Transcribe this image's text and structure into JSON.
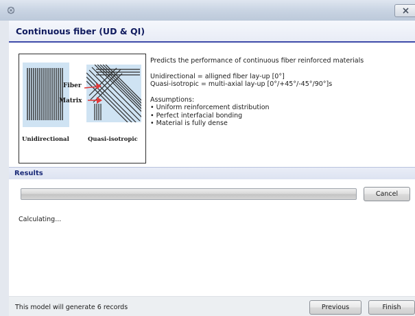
{
  "window": {
    "icon": "app-icon",
    "close_icon": "close-icon"
  },
  "header": {
    "title": "Continuous fiber (UD & QI)"
  },
  "diagram": {
    "fiber_label": "Fiber",
    "matrix_label": "Matrix",
    "unidirectional_label": "Unidirectional",
    "quasi_isotropic_label": "Quasi-isotropic",
    "accent_color": "#e03a3a",
    "panel_color": "#cfe3f3"
  },
  "description": {
    "intro": "Predicts the performance of continuous fiber reinforced materials",
    "unidirectional": "Unidirectional = alligned fiber lay-up [0°]",
    "quasi_isotropic": "Quasi-isotropic = multi-axial lay-up [0°/+45°/-45°/90°]s",
    "assumptions_heading": "Assumptions:",
    "assumptions": [
      "• Uniform reinforcement distribution",
      "• Perfect interfacial bonding",
      "• Material is fully dense"
    ]
  },
  "results": {
    "title": "Results",
    "progress": 0,
    "cancel_label": "Cancel",
    "status": "Calculating..."
  },
  "footer": {
    "text": "This model will generate 6 records",
    "previous_label": "Previous",
    "finish_label": "Finish"
  }
}
